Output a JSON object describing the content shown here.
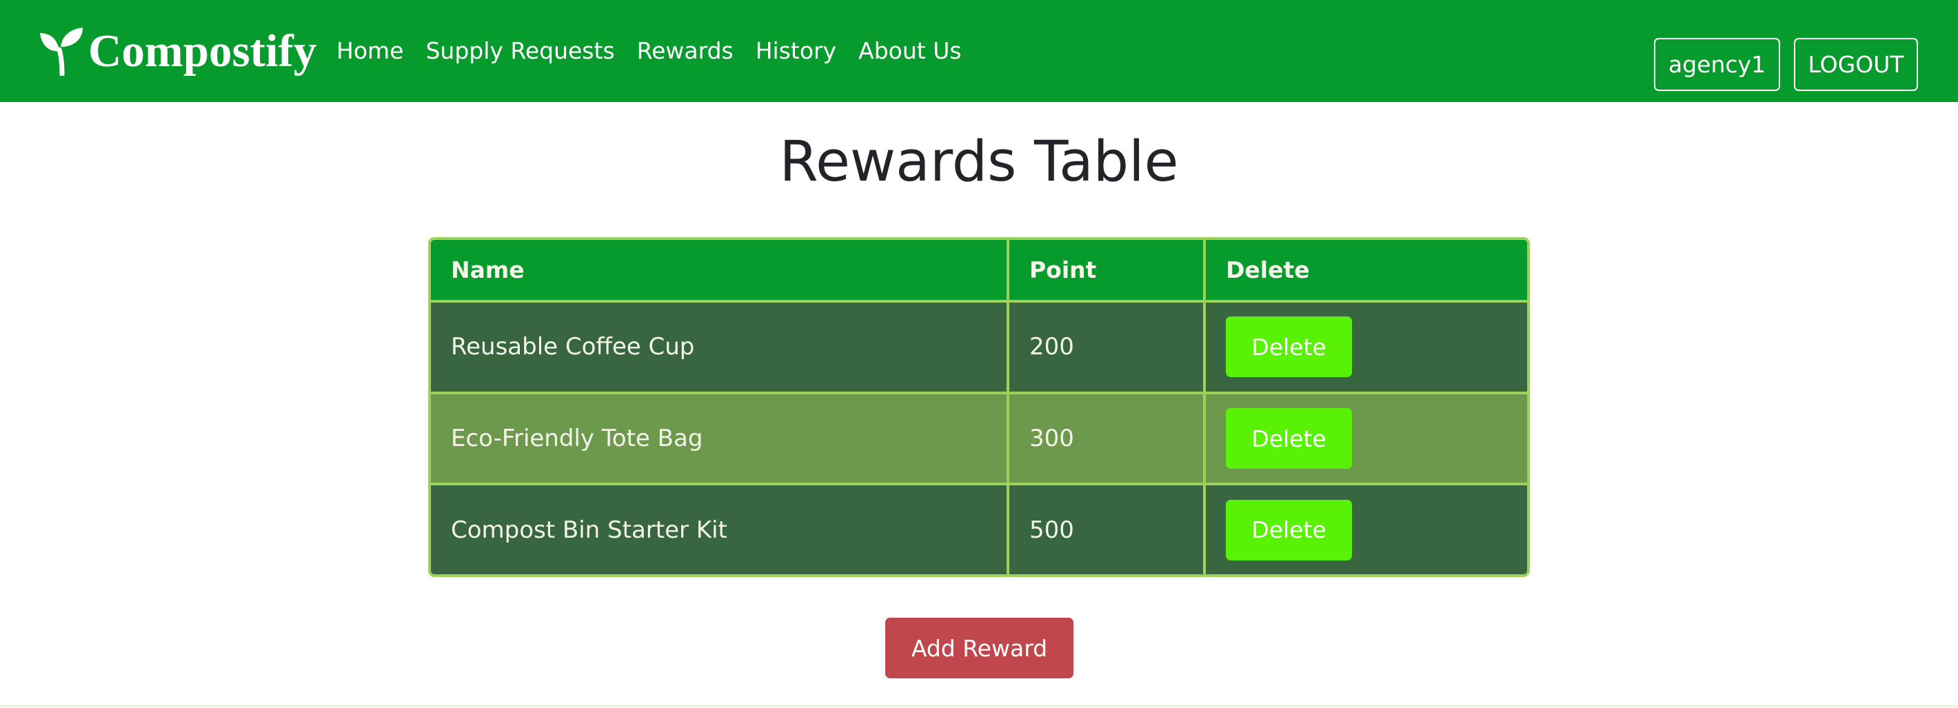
{
  "navbar": {
    "brand": "Compostify",
    "brand_icon": "sprout-icon",
    "links": [
      "Home",
      "Supply Requests",
      "Rewards",
      "History",
      "About Us"
    ],
    "user_label": "agency1",
    "logout_label": "LOGOUT"
  },
  "page": {
    "title": "Rewards Table"
  },
  "table": {
    "headers": [
      "Name",
      "Point",
      "Delete"
    ],
    "rows": [
      {
        "name": "Reusable Coffee Cup",
        "point": "200",
        "action": "Delete"
      },
      {
        "name": "Eco-Friendly Tote Bag",
        "point": "300",
        "action": "Delete"
      },
      {
        "name": "Compost Bin Starter Kit",
        "point": "500",
        "action": "Delete"
      }
    ]
  },
  "actions": {
    "add_label": "Add Reward"
  },
  "colors": {
    "navbar": "#079a2d",
    "row_dark": "#376641",
    "row_light": "#6c994c",
    "table_border": "#9ed05a",
    "delete_button": "#59f105",
    "add_button": "#c0474c"
  }
}
